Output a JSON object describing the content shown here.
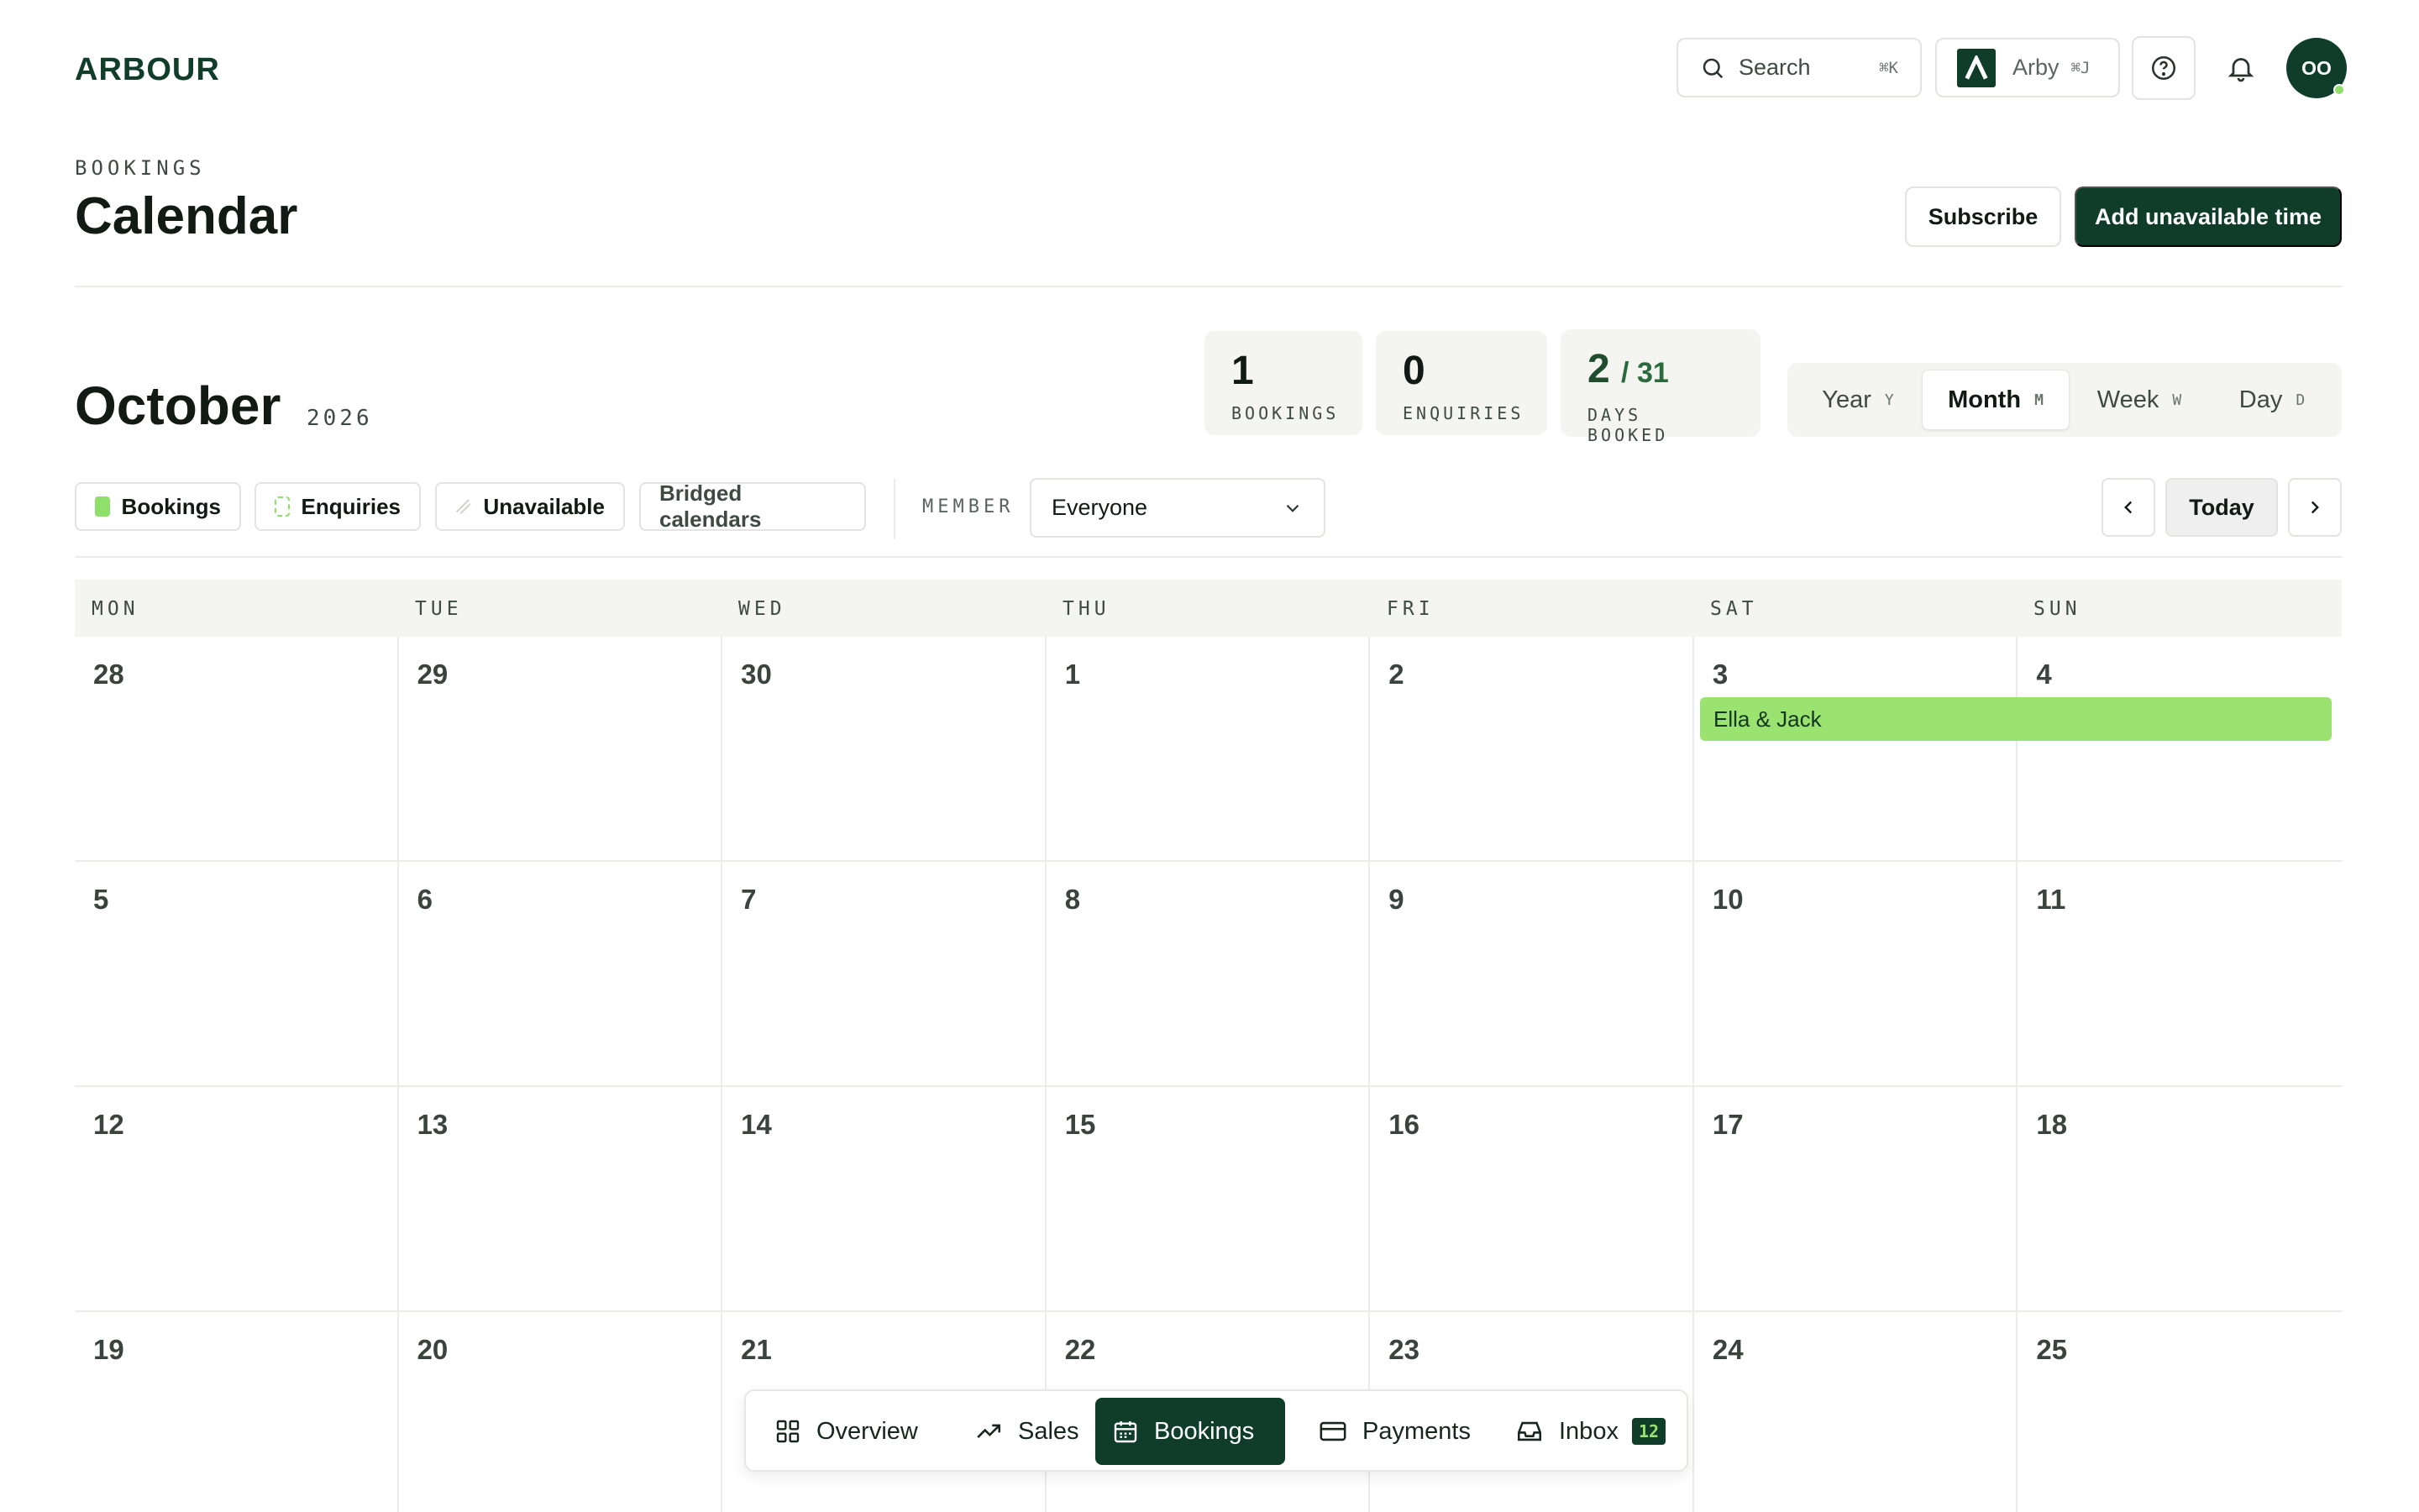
{
  "header": {
    "logo": "ARBOUR",
    "search_label": "Search",
    "search_shortcut": "⌘K",
    "workspace_label": "Arby",
    "workspace_shortcut": "⌘J",
    "avatar_initials": "OO"
  },
  "page": {
    "eyebrow": "BOOKINGS",
    "title": "Calendar",
    "subscribe_label": "Subscribe",
    "add_label": "Add unavailable time"
  },
  "period": {
    "month": "October",
    "year": "2026"
  },
  "stats": {
    "bookings": {
      "value": "1",
      "label": "BOOKINGS"
    },
    "enquiries": {
      "value": "0",
      "label": "ENQUIRIES"
    },
    "days": {
      "value": "2",
      "total": "/ 31",
      "label": "DAYS BOOKED"
    }
  },
  "views": [
    {
      "label": "Year",
      "key": "Y"
    },
    {
      "label": "Month",
      "key": "M",
      "active": true
    },
    {
      "label": "Week",
      "key": "W"
    },
    {
      "label": "Day",
      "key": "D"
    }
  ],
  "filters": {
    "bookings": "Bookings",
    "enquiries": "Enquiries",
    "unavailable": "Unavailable",
    "bridged": "Bridged calendars",
    "member_label": "MEMBER",
    "member_value": "Everyone",
    "today": "Today"
  },
  "calendar": {
    "weekdays": [
      "MON",
      "TUE",
      "WED",
      "THU",
      "FRI",
      "SAT",
      "SUN"
    ],
    "weeks": [
      [
        "28",
        "29",
        "30",
        "1",
        "2",
        "3",
        "4"
      ],
      [
        "5",
        "6",
        "7",
        "8",
        "9",
        "10",
        "11"
      ],
      [
        "12",
        "13",
        "14",
        "15",
        "16",
        "17",
        "18"
      ],
      [
        "19",
        "20",
        "21",
        "22",
        "23",
        "24",
        "25"
      ]
    ],
    "event": "Ella & Jack"
  },
  "colors": {
    "brand": "#0f3d2a",
    "booking": "#9be370"
  },
  "dock": {
    "overview": "Overview",
    "sales": "Sales",
    "bookings": "Bookings",
    "payments": "Payments",
    "inbox": "Inbox",
    "inbox_count": "12"
  }
}
